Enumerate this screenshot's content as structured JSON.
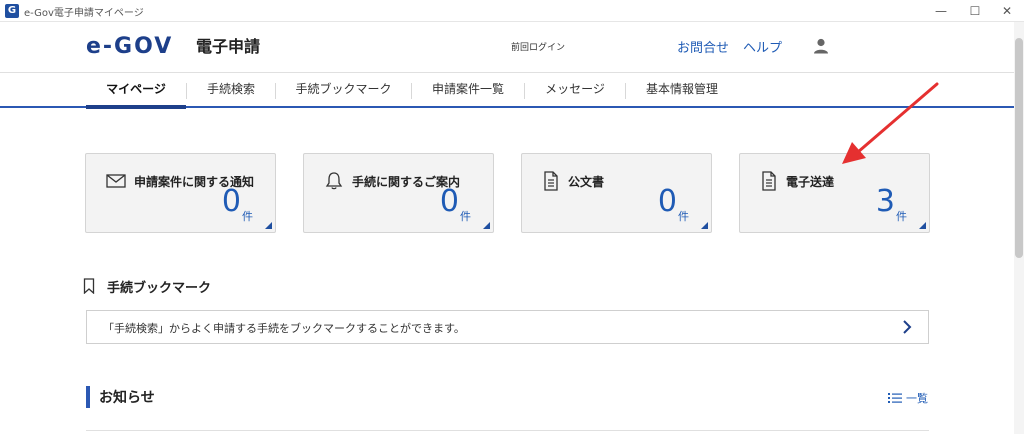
{
  "window": {
    "title": "e-Gov電子申請マイページ",
    "app_icon_letter": "G",
    "minimize": "—",
    "maximize": "☐",
    "close": "✕"
  },
  "header": {
    "logo_mark": "e-GOV",
    "logo_sub": "電子申請",
    "last_login": "前回ログイン",
    "inquiry": "お問合せ",
    "help": "ヘルプ"
  },
  "nav": {
    "items": [
      {
        "label": "マイページ",
        "active": true
      },
      {
        "label": "手続検索"
      },
      {
        "label": "手続ブックマーク"
      },
      {
        "label": "申請案件一覧"
      },
      {
        "label": "メッセージ"
      },
      {
        "label": "基本情報管理"
      }
    ]
  },
  "cards": [
    {
      "title": "申請案件に関する通知",
      "count": "0",
      "unit": "件",
      "icon": "envelope-icon"
    },
    {
      "title": "手続に関するご案内",
      "count": "0",
      "unit": "件",
      "icon": "bell-icon"
    },
    {
      "title": "公文書",
      "count": "0",
      "unit": "件",
      "icon": "document-icon"
    },
    {
      "title": "電子送達",
      "count": "3",
      "unit": "件",
      "icon": "document-icon"
    }
  ],
  "bookmark": {
    "title": "手続ブックマーク",
    "text": "「手続検索」からよく申請する手続をブックマークすることができます。"
  },
  "news": {
    "title": "お知らせ",
    "list_label": "一覧"
  },
  "colors": {
    "brand": "#1d3f8a",
    "accent": "#1f5bb5",
    "annotation": "#e53030"
  }
}
